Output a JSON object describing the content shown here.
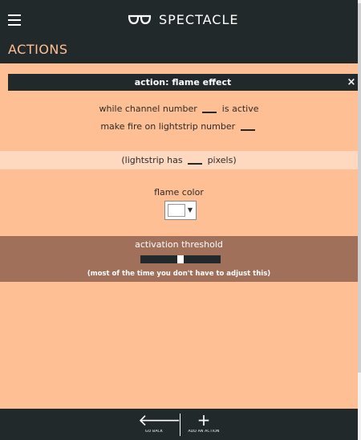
{
  "header": {
    "app_name": "SPECTACLE",
    "logo_icon": "glasses-icon",
    "section": "ACTIONS"
  },
  "modal": {
    "title": "action: flame effect",
    "close_label": "×"
  },
  "form": {
    "line1_before": "while channel number",
    "line1_after": "is active",
    "line2_before": "make fire on lightstrip number",
    "lightstrip_before": "(lightstrip has",
    "lightstrip_after": "pixels)",
    "flame_color_label": "flame color",
    "flame_color_value": "#ffffff",
    "threshold_label": "activation threshold",
    "threshold_level": 0.5,
    "threshold_note": "(most of the time you don't have to adjust this)"
  },
  "bottom_nav": {
    "back_label": "GO BACK",
    "add_label": "ADD AN ACTION"
  },
  "colors": {
    "dark": "#22292a",
    "peach": "#ffbf95",
    "light_peach": "#ffd8c0",
    "brown": "#a0705a"
  }
}
